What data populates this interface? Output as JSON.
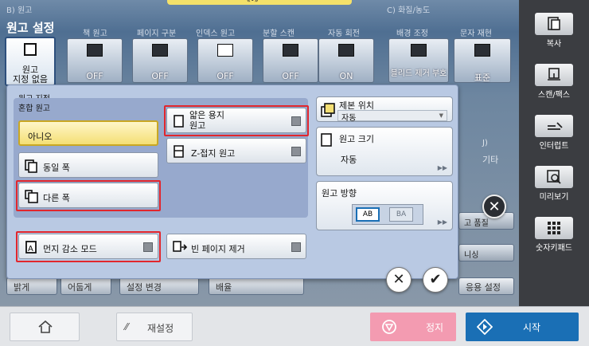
{
  "screen": {
    "group_b_label": "B) 원고",
    "group_c_label": "C) 화질/농도",
    "top_indicator": "«•»",
    "title": "원고 설정",
    "tabs": [
      {
        "label": "책 원고",
        "value": "OFF"
      },
      {
        "label": "페이지 구분",
        "value": "OFF"
      },
      {
        "label": "인덱스 원고",
        "value": "OFF"
      },
      {
        "label": "분할 스캔",
        "value": "OFF"
      },
      {
        "label": "자동 회전",
        "value": "ON"
      },
      {
        "label": "배경 조정",
        "value": "블리드 제거 부호"
      },
      {
        "label": "문자 재현",
        "value": "표준"
      }
    ],
    "selected_tile_value": "원고\n지정 없음",
    "bg_row": {
      "right_hint": "J)",
      "other": "기타",
      "quality": "고 품질",
      "color": "니싱"
    },
    "bottom_btns": {
      "bright": "밝게",
      "dark": "어둡게",
      "change": "설정 변경",
      "ratio": "배율",
      "app": "응용 설정"
    }
  },
  "dialog": {
    "title": "원고 지정",
    "mixed_label": "혼합 원고",
    "no": "아니오",
    "same_width": "동일 폭",
    "diff_width": "다른 폭",
    "thin_paper": "얇은 용지\n원고",
    "zfold": "Z-접지 원고",
    "binding": {
      "label": "제본 위치",
      "value": "자동"
    },
    "size": {
      "label": "원고 크기",
      "value": "자동"
    },
    "orientation": {
      "label": "원고 방향"
    },
    "dust": "먼지 감소 모드",
    "blank": "빈 페이지 제거",
    "cancel": "✕",
    "ok": "✔",
    "close": "✕"
  },
  "sidebar": {
    "items": [
      "복사",
      "스캔/팩스",
      "인터럽트",
      "미리보기",
      "숫자키패드"
    ]
  },
  "bottombar": {
    "reset": "재설정",
    "stop": "정지",
    "start": "시작"
  },
  "colors": {
    "accent_start": "#1a6fb5",
    "stop": "#f39bb1",
    "highlight": "#e2262c"
  }
}
